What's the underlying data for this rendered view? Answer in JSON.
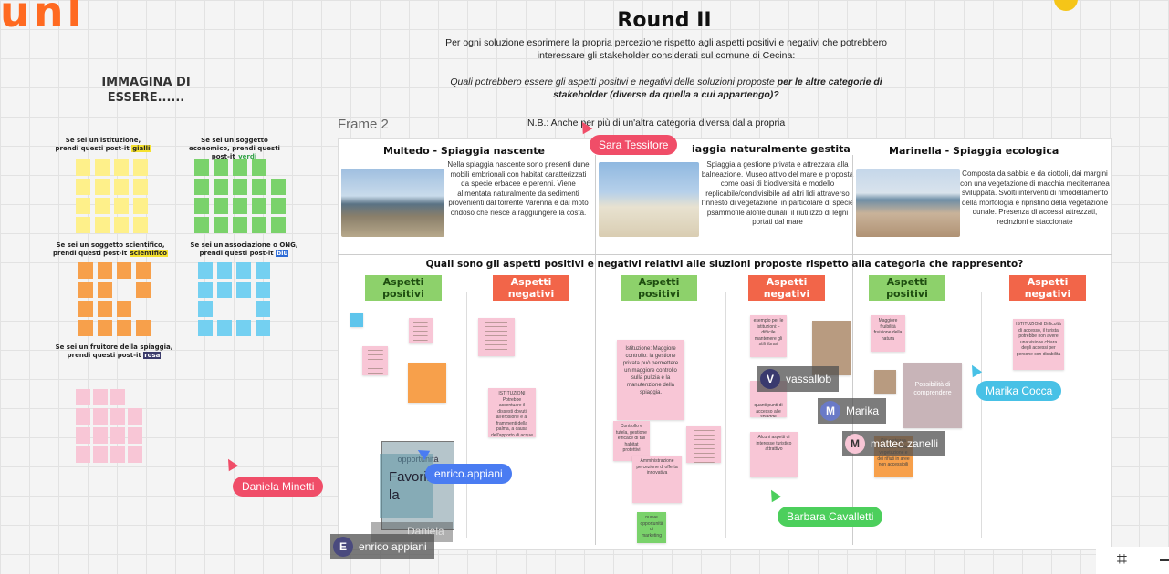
{
  "board": {
    "logo_text": "unl",
    "round_title": "Round II",
    "round_intro": "Per ogni soluzione esprimere la propria percezione rispetto agli aspetti positivi e negativi che potrebbero interessare gli stakeholder considerati sul comune di Cecina:",
    "round_question_plain": "Quali potrebbero essere gli aspetti positivi e negativi delle soluzioni proposte ",
    "round_question_bold": "per le altre categorie di stakeholder (diverse da quella a cui appartengo)?",
    "nb_note": "N.B.: Anche per più di un'altra categoria diversa dalla propria",
    "frame_label": "Frame 2"
  },
  "left_panel": {
    "heading": "IMMAGINA DI ESSERE......",
    "categories": [
      {
        "label": "Se sei un'istituzione, prendi questi post-it",
        "tag": "gialli",
        "tag_bg": "#f5e12f",
        "color": "#fef08a"
      },
      {
        "label": "Se sei un soggetto economico, prendi questi post-it",
        "tag": "verdi",
        "tag_bg": "#ffffff",
        "color": "#7ad26b"
      },
      {
        "label": "Se sei un soggetto scientifico, prendi questi post-it",
        "tag": "scientifico",
        "tag_bg": "#f5e12f",
        "color": "#f7a04b"
      },
      {
        "label": "Se sei un'associazione o ONG, prendi questi post-it",
        "tag": "blu",
        "tag_bg": "#2d6bd6",
        "color": "#74d0f1"
      },
      {
        "label": "Se sei un fruitore della spiaggia, prendi questi post-it",
        "tag": "rosa",
        "tag_bg": "#3b3b6b",
        "color": "#f8c6d6"
      }
    ]
  },
  "solutions": [
    {
      "title": "Multedo - Spiaggia nascente",
      "desc": "Nella spiaggia nascente sono presenti dune mobili embrionali con habitat caratterizzati da specie erbacee e perenni. Viene alimentata naturalmente da sedimenti provenienti dal torrente Varenna e dal moto ondoso che riesce a raggiungere la costa."
    },
    {
      "title": "iaggia naturalmente gestita",
      "desc": "Spiaggia a gestione privata e attrezzata alla balneazione. Museo attivo del mare e proposta come oasi di biodiversità e modello replicabile/condivisibile ad altri lidi attraverso l'innesto di vegetazione, in particolare di specie psammofile alofile dunali, il riutilizzo di legni portati dal mare"
    },
    {
      "title": "Marinella - Spiaggia ecologica",
      "desc": "Composta da sabbia e da ciottoli, dai margini con una vegetazione di macchia mediterranea sviluppata. Svolti interventi di rimodellamento della morfologia e ripristino della vegetazione dunale. Presenza di accessi attrezzati, recinzioni e staccionate"
    }
  ],
  "question": "Quali sono gli aspetti positivi e negativi relativi alle sluzioni proposte rispetto alla categoria che rappresento?",
  "aspects": {
    "positive": "Aspetti positivi",
    "negative": "Aspetti negativi"
  },
  "notes": {
    "istituzioni": "ISTITUZIONI Potrebbe accentuare il dissesti dovuti all'erosione e ai frammenti della palma, a causa dell'apporto di acque eutrofizzate",
    "istituzione_mug": "Istituzione: Maggiore controllo: la gestione privata può permettere un maggiore controllo sulla pulizia e la manutenzione della spiaggia.",
    "controllo": "Controllo e tutela, gestione efficace di tali habitat protettivi",
    "amministrazione": "Amministrazione percezione di offerta innovativa",
    "marketing": "nuove opportunità di marketing",
    "esempio": "esempio per le istituzioni: - difficile mantenere gli stili librari",
    "quanti": "quanti punti di accesso alle spiagge turistiche",
    "alcuni": "Alcuni aspetti di interesse turistico attrattivo",
    "vegetazione": "Più certezza costante della vegetazione e dei rifiuti in aree non accessibili",
    "possibilita": "Possibilità di comprendere",
    "istituzioni_marinella": "ISTITUZIONI Difficoltà di accesso, il turista potrebbe non avere una visione chiara degli accessi per persone con disabilità",
    "maggiore": "Maggiore fruibilità fruizione della natura",
    "opportunita": "opportunità",
    "favorire": "Favorire la"
  },
  "collaborators": {
    "sara": "Sara Tessitore",
    "vassallob": "vassallob",
    "marika": "Marika",
    "marika_cocca": "Marika Cocca",
    "matteo": "matteo zanelli",
    "enrico_appiani_tag": "enrico.appiani",
    "daniela_minetti": "Daniela Minetti",
    "daniela_ghost": "Daniela",
    "barbara": "Barbara Cavalletti",
    "enrico_chip": "enrico appiani",
    "initials": {
      "vassallob": "V",
      "marika": "M",
      "matteo": "M",
      "enrico": "E"
    }
  },
  "colors": {
    "accent_pink": "#f04d68",
    "accent_blue": "#4a7cf2",
    "accent_cyan": "#48c1e6",
    "accent_green": "#4ccf5c"
  }
}
